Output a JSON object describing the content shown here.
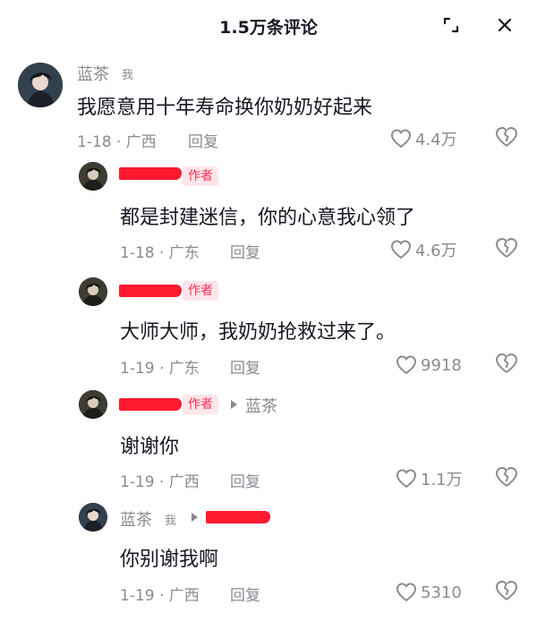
{
  "header": {
    "title": "1.5万条评论",
    "expand_icon": "expand-icon",
    "close_icon": "close-icon"
  },
  "comments": [
    {
      "username": "蓝茶",
      "self_tag": "我",
      "text": "我愿意用十年寿命换你奶奶好起来",
      "meta": "1-18 · 广西",
      "reply_label": "回复",
      "likes": "4.4万"
    },
    {
      "author_tag": "作者",
      "text": "都是封建迷信，你的心意我心领了",
      "meta": "1-18 · 广东",
      "reply_label": "回复",
      "likes": "4.6万"
    },
    {
      "author_tag": "作者",
      "text": "大师大师，我奶奶抢救过来了。",
      "meta": "1-19 · 广东",
      "reply_label": "回复",
      "likes": "9918"
    },
    {
      "author_tag": "作者",
      "reply_to": "蓝茶",
      "text": "谢谢你",
      "meta": "1-19 · 广西",
      "reply_label": "回复",
      "likes": "1.1万"
    },
    {
      "username": "蓝茶",
      "self_tag": "我",
      "text": "你别谢我啊",
      "meta": "1-19 · 广西",
      "reply_label": "回复",
      "likes": "5310"
    }
  ],
  "colors": {
    "accent": "#fe2c55",
    "redaction": "#ff1a2e",
    "muted": "#8a8b91",
    "text": "#161823"
  }
}
